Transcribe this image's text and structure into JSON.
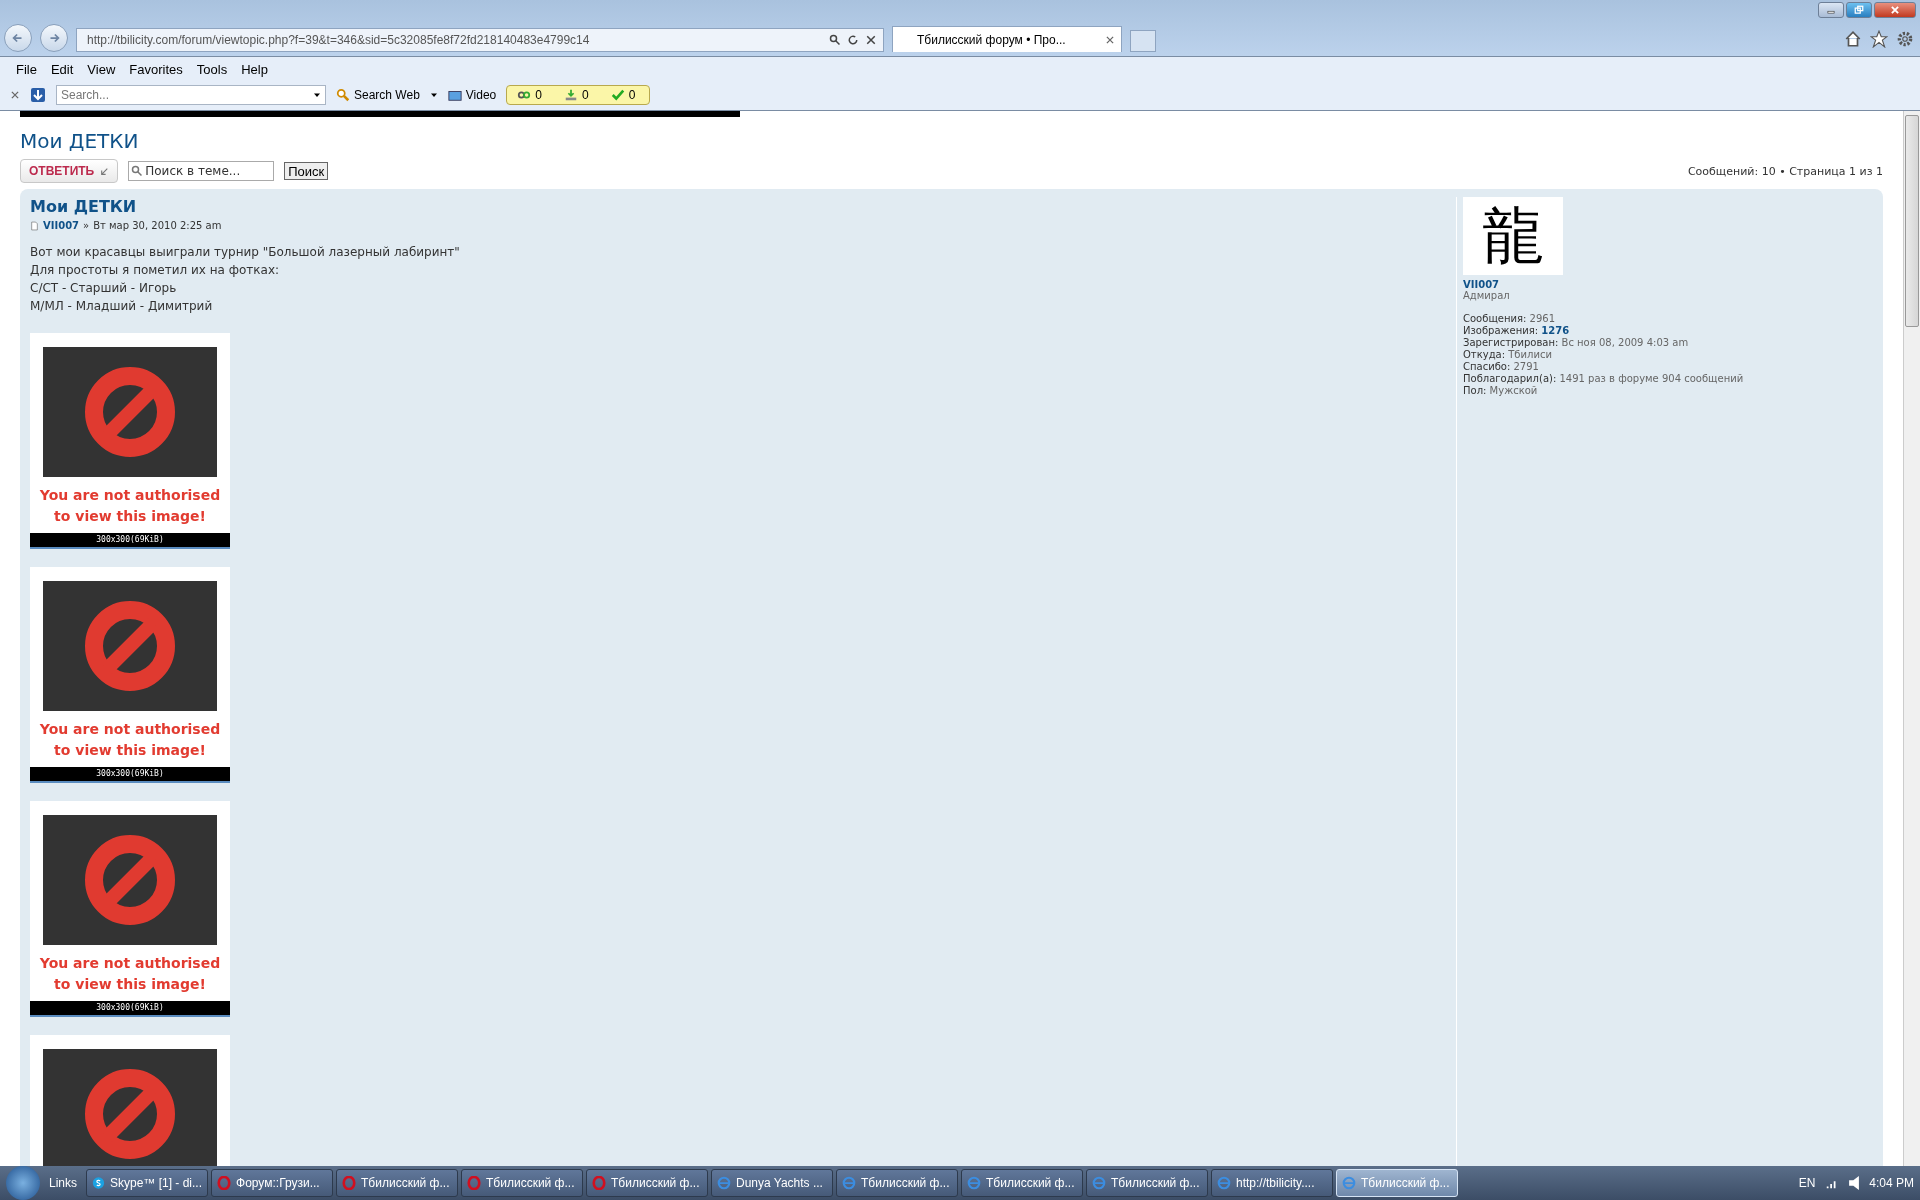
{
  "browser": {
    "address": "http://tbilicity.com/forum/viewtopic.php?f=39&t=346&sid=5c32085fe8f72fd218140483e4799c14",
    "tab_title": "Тбилисский форум • Про...",
    "menu": [
      "File",
      "Edit",
      "View",
      "Favorites",
      "Tools",
      "Help"
    ],
    "toolbar": {
      "search_placeholder": "Search...",
      "search_web": "Search Web",
      "video": "Video",
      "counters": [
        "0",
        "0",
        "0"
      ]
    }
  },
  "page": {
    "title": "Мои ДЕТКИ",
    "reply_button": "ОТВЕТИТЬ",
    "search_placeholder": "Поиск в теме...",
    "search_button": "Поиск",
    "pagination": "Сообщений: 10 • Страница 1 из 1"
  },
  "post": {
    "title": "Мои ДЕТКИ",
    "author": "VII007",
    "separator": "»",
    "date": "Вт мар 30, 2010 2:25 am",
    "lines": [
      "Вот мои красавцы выиграли турнир \"Большой лазерный лабиринт\"",
      "Для простоты я пометил их на фотках:",
      "С/СТ - Старший - Игорь",
      "М/МЛ - Младший - Димитрий"
    ],
    "images": [
      {
        "kind": "blocked",
        "message": "You are not authorised to view this image!",
        "size": "300x300(69KiB)"
      },
      {
        "kind": "blocked",
        "message": "You are not authorised to view this image!",
        "size": "300x300(69KiB)"
      },
      {
        "kind": "blocked",
        "message": "You are not authorised to view this image!",
        "size": "300x300(69KiB)"
      },
      {
        "kind": "blocked"
      }
    ],
    "profile": {
      "avatar_glyph": "龍",
      "name": "VII007",
      "rank": "Адмирал",
      "stats": [
        {
          "label": "Сообщения:",
          "value": "2961",
          "highlight": false
        },
        {
          "label": "Изображения:",
          "value": "1276",
          "highlight": true
        },
        {
          "label": "Зарегистрирован:",
          "value": "Вс ноя 08, 2009 4:03 am",
          "highlight": false
        },
        {
          "label": "Откуда:",
          "value": "Тбилиси",
          "highlight": false
        },
        {
          "label": "Спасибо:",
          "value": "2791",
          "highlight": false
        },
        {
          "label": "Поблагодарил(а):",
          "value": "1491 раз в форуме 904 сообщений",
          "highlight": false
        },
        {
          "label": "Пол:",
          "value": "Мужской",
          "highlight": false
        }
      ]
    }
  },
  "taskbar": {
    "links": "Links",
    "items": [
      {
        "kind": "skype",
        "label": "Skype™ [1] - di...",
        "selected": false
      },
      {
        "kind": "opera",
        "label": "Форум::Грузи...",
        "selected": false
      },
      {
        "kind": "opera",
        "label": "Тбилисский ф...",
        "selected": false
      },
      {
        "kind": "opera",
        "label": "Тбилисский ф...",
        "selected": false
      },
      {
        "kind": "opera",
        "label": "Тбилисский ф...",
        "selected": false
      },
      {
        "kind": "ie",
        "label": "Dunya Yachts ...",
        "selected": false
      },
      {
        "kind": "ie",
        "label": "Тбилисский ф...",
        "selected": false
      },
      {
        "kind": "ie",
        "label": "Тбилисский ф...",
        "selected": false
      },
      {
        "kind": "ie",
        "label": "Тбилисский ф...",
        "selected": false
      },
      {
        "kind": "ie",
        "label": "http://tbilicity....",
        "selected": false
      },
      {
        "kind": "ie",
        "label": "Тбилисский ф...",
        "selected": true
      }
    ],
    "language": "EN",
    "time": "4:04 PM"
  }
}
